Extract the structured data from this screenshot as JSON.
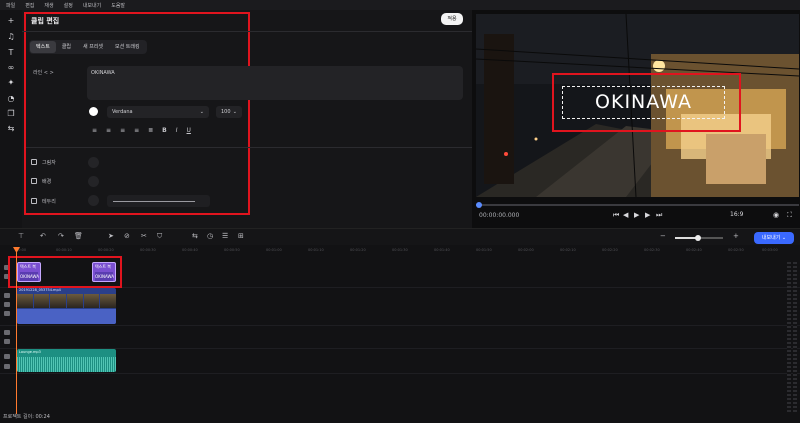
{
  "menu": [
    "파일",
    "편집",
    "재생",
    "설정",
    "내보내기",
    "도움말"
  ],
  "left_toolbar": [
    "plus-icon",
    "music-note-icon",
    "text-icon",
    "infinity-icon",
    "sparkle-icon",
    "sticker-icon",
    "layers-icon",
    "link-icon"
  ],
  "editor": {
    "title": "클립 편집",
    "apply_label": "적용",
    "tabs": [
      "텍스트",
      "클립",
      "새 프리셋",
      "모션 트래킹"
    ],
    "active_tab": 0,
    "line_label": "라인 < >",
    "text_value": "OKINAWA",
    "font": "Verdana",
    "font_size": "100",
    "align_buttons": [
      "align-left",
      "align-center",
      "align-right",
      "justify",
      "justify-all",
      "bold",
      "italic",
      "underline"
    ],
    "options": [
      {
        "label": "그림자",
        "checked": false
      },
      {
        "label": "배경",
        "checked": false
      },
      {
        "label": "테두리",
        "checked": false
      }
    ]
  },
  "preview": {
    "overlay_text": "OKINAWA",
    "timecode": "00:00:00.000",
    "aspect": "16:9",
    "progress": 0.0
  },
  "timeline": {
    "export_label": "내보내기",
    "ruler": [
      "00:00",
      "00:00:10",
      "00:00:20",
      "00:00:30",
      "00:00:40",
      "00:00:50",
      "00:01:00",
      "00:01:10",
      "00:01:20",
      "00:01:30",
      "00:01:40",
      "00:01:50",
      "00:02:00",
      "00:02:10",
      "00:02:20",
      "00:02:30",
      "00:02:40",
      "00:02:50",
      "00:03:00"
    ],
    "title_clips": [
      {
        "name": "텍스트 복",
        "text": "OKINAWA"
      },
      {
        "name": "텍스트 복",
        "text": "OKINAWA"
      }
    ],
    "video_clip_name": "20191228_053754.mp4",
    "audio_clip_name": "Lounge.mp3",
    "project_length": "프로젝트 길이: 00:24"
  },
  "colors": {
    "accent": "#3a69ff",
    "highlight": "#e0141e",
    "playhead": "#ff7a2e",
    "title_clip": "#7a4fd0",
    "video_clip": "#2a3f8a",
    "audio_clip": "#1d8f82"
  }
}
